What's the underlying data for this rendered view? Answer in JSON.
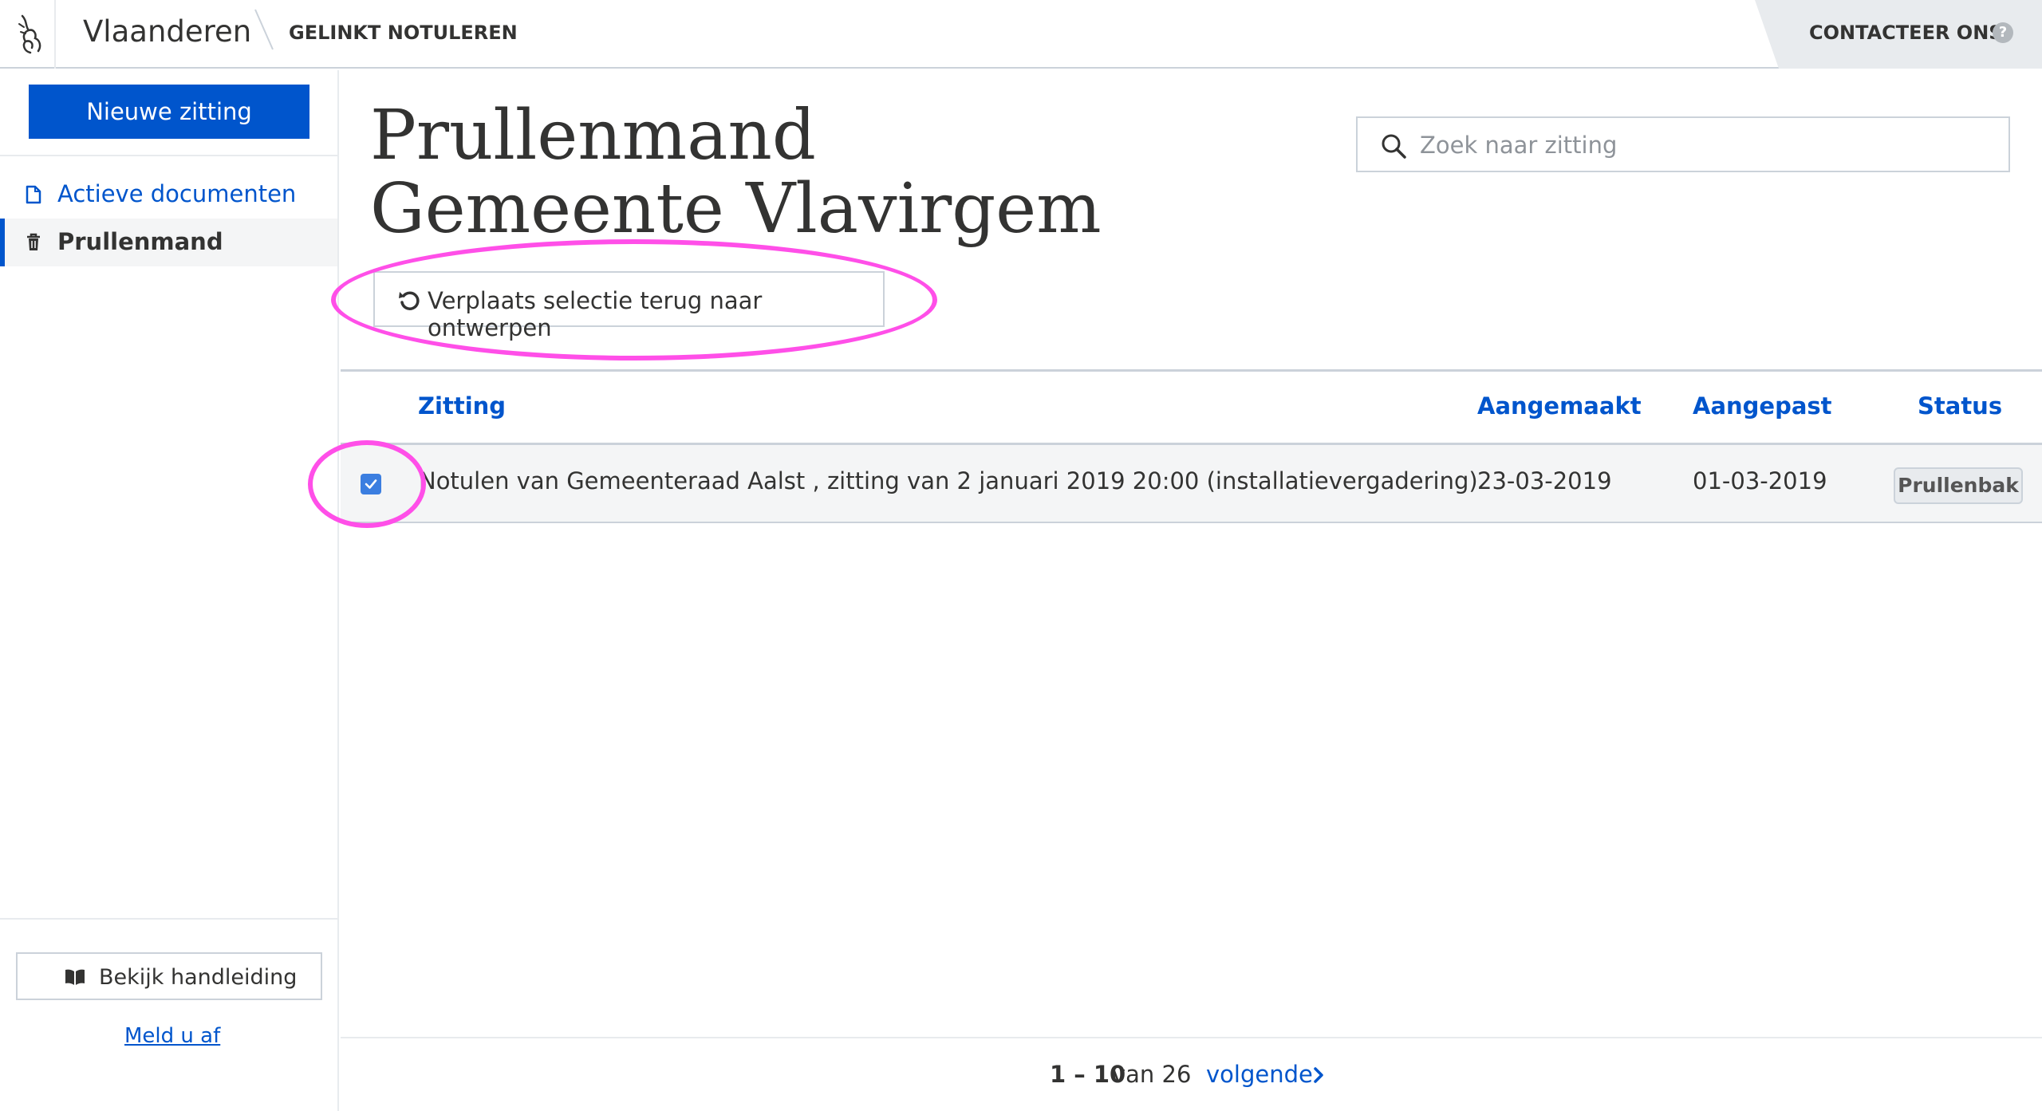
{
  "header": {
    "brand": "Vlaanderen",
    "app_name": "GELINKT NOTULEREN",
    "contact_label": "CONTACTEER ONS",
    "help_glyph": "?"
  },
  "sidebar": {
    "new_session_label": "Nieuwe zitting",
    "items": [
      {
        "label": "Actieve documenten",
        "icon": "document-icon",
        "active": false
      },
      {
        "label": "Prullenmand",
        "icon": "trash-icon",
        "active": true
      }
    ],
    "manual_label": "Bekijk handleiding",
    "logout_label": "Meld u af"
  },
  "main": {
    "title": "Prullenmand Gemeente Vlavirgem",
    "search_placeholder": "Zoek naar zitting",
    "restore_label": "Verplaats selectie terug naar ontwerpen",
    "table": {
      "headers": [
        "Zitting",
        "Aangemaakt",
        "Aangepast",
        "Status"
      ],
      "rows": [
        {
          "checked": true,
          "title": "Notulen van Gemeenteraad Aalst , zitting van 2 januari 2019 20:00  (installatievergadering)",
          "created": "23-03-2019",
          "modified": "01-03-2019",
          "status": "Prullenbak"
        }
      ]
    },
    "pagination": {
      "range": "1 – 10",
      "total": "van 26",
      "next_label": "volgende"
    }
  },
  "colors": {
    "accent": "#0055cc",
    "annotation": "#ff4fe8"
  }
}
